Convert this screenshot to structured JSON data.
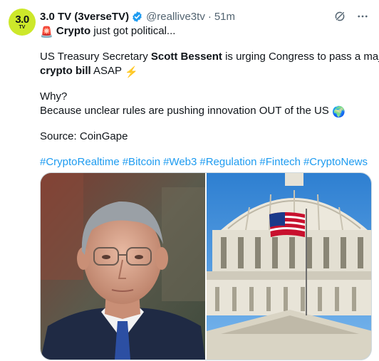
{
  "post": {
    "avatar": {
      "big": "3.0",
      "small": "TV",
      "color": "#cde82a"
    },
    "author_name": "3.0 TV (3verseTV)",
    "handle": "@reallive3tv",
    "separator": "·",
    "time": "51m",
    "verified_icon": "verified-badge-icon",
    "action_icons": [
      "grok-icon",
      "more-icon"
    ],
    "text": {
      "line1": {
        "emoji": "🚨",
        "bold": "Crypto",
        "rest": " just got political..."
      },
      "line2": {
        "pre": "US Treasury Secretary ",
        "bold": "Scott Bessent",
        "post": " is urging Congress to pass a major"
      },
      "line3": {
        "bold": "crypto bill",
        "post": " ASAP ",
        "emoji": "⚡"
      },
      "line4": "Why?",
      "line5": {
        "text": "Because unclear rules are pushing innovation OUT of the US ",
        "emoji": "🌍"
      },
      "line6": "Source: CoinGape"
    },
    "hashtags": [
      "#CryptoRealtime",
      "#Bitcoin",
      "#Web3",
      "#Regulation",
      "#Fintech",
      "#CryptoNews"
    ],
    "media": [
      {
        "description": "portrait-photo"
      },
      {
        "description": "capitol-dome-photo"
      }
    ]
  },
  "colors": {
    "link": "#1d9bf0",
    "muted": "#536471",
    "text": "#0f1419",
    "verified": "#1d9bf0"
  }
}
